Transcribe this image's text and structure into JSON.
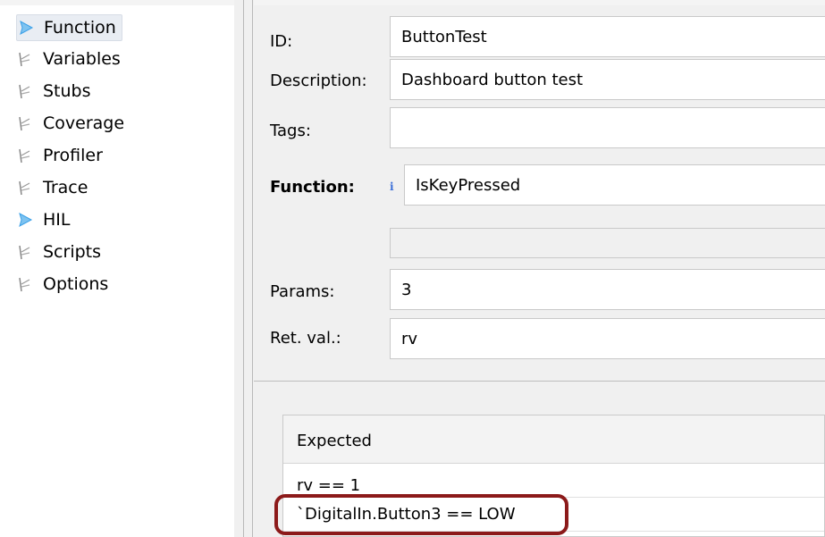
{
  "sidebar": {
    "items": [
      {
        "label": "Function",
        "icon": "play-arrow-icon",
        "selected": true
      },
      {
        "label": "Variables",
        "icon": "wand-icon"
      },
      {
        "label": "Stubs",
        "icon": "wand-icon"
      },
      {
        "label": "Coverage",
        "icon": "wand-icon"
      },
      {
        "label": "Profiler",
        "icon": "wand-icon"
      },
      {
        "label": "Trace",
        "icon": "wand-icon"
      },
      {
        "label": "HIL",
        "icon": "play-arrow-icon"
      },
      {
        "label": "Scripts",
        "icon": "wand-icon"
      },
      {
        "label": "Options",
        "icon": "wand-icon"
      }
    ]
  },
  "form": {
    "id_label": "ID:",
    "id_value": "ButtonTest",
    "description_label": "Description:",
    "description_value": "Dashboard button test",
    "tags_label": "Tags:",
    "tags_value": "",
    "function_label": "Function:",
    "function_info": "i",
    "function_value": "IsKeyPressed",
    "extra_value": "",
    "params_label": "Params:",
    "params_value": "3",
    "retval_label": "Ret. val.:",
    "retval_value": "rv"
  },
  "expected_table": {
    "header": "Expected",
    "rows": [
      "rv == 1",
      "`DigitalIn.Button3 == LOW"
    ]
  },
  "colors": {
    "play_icon": "#3aa0e8",
    "highlight": "#8c1a1a"
  }
}
